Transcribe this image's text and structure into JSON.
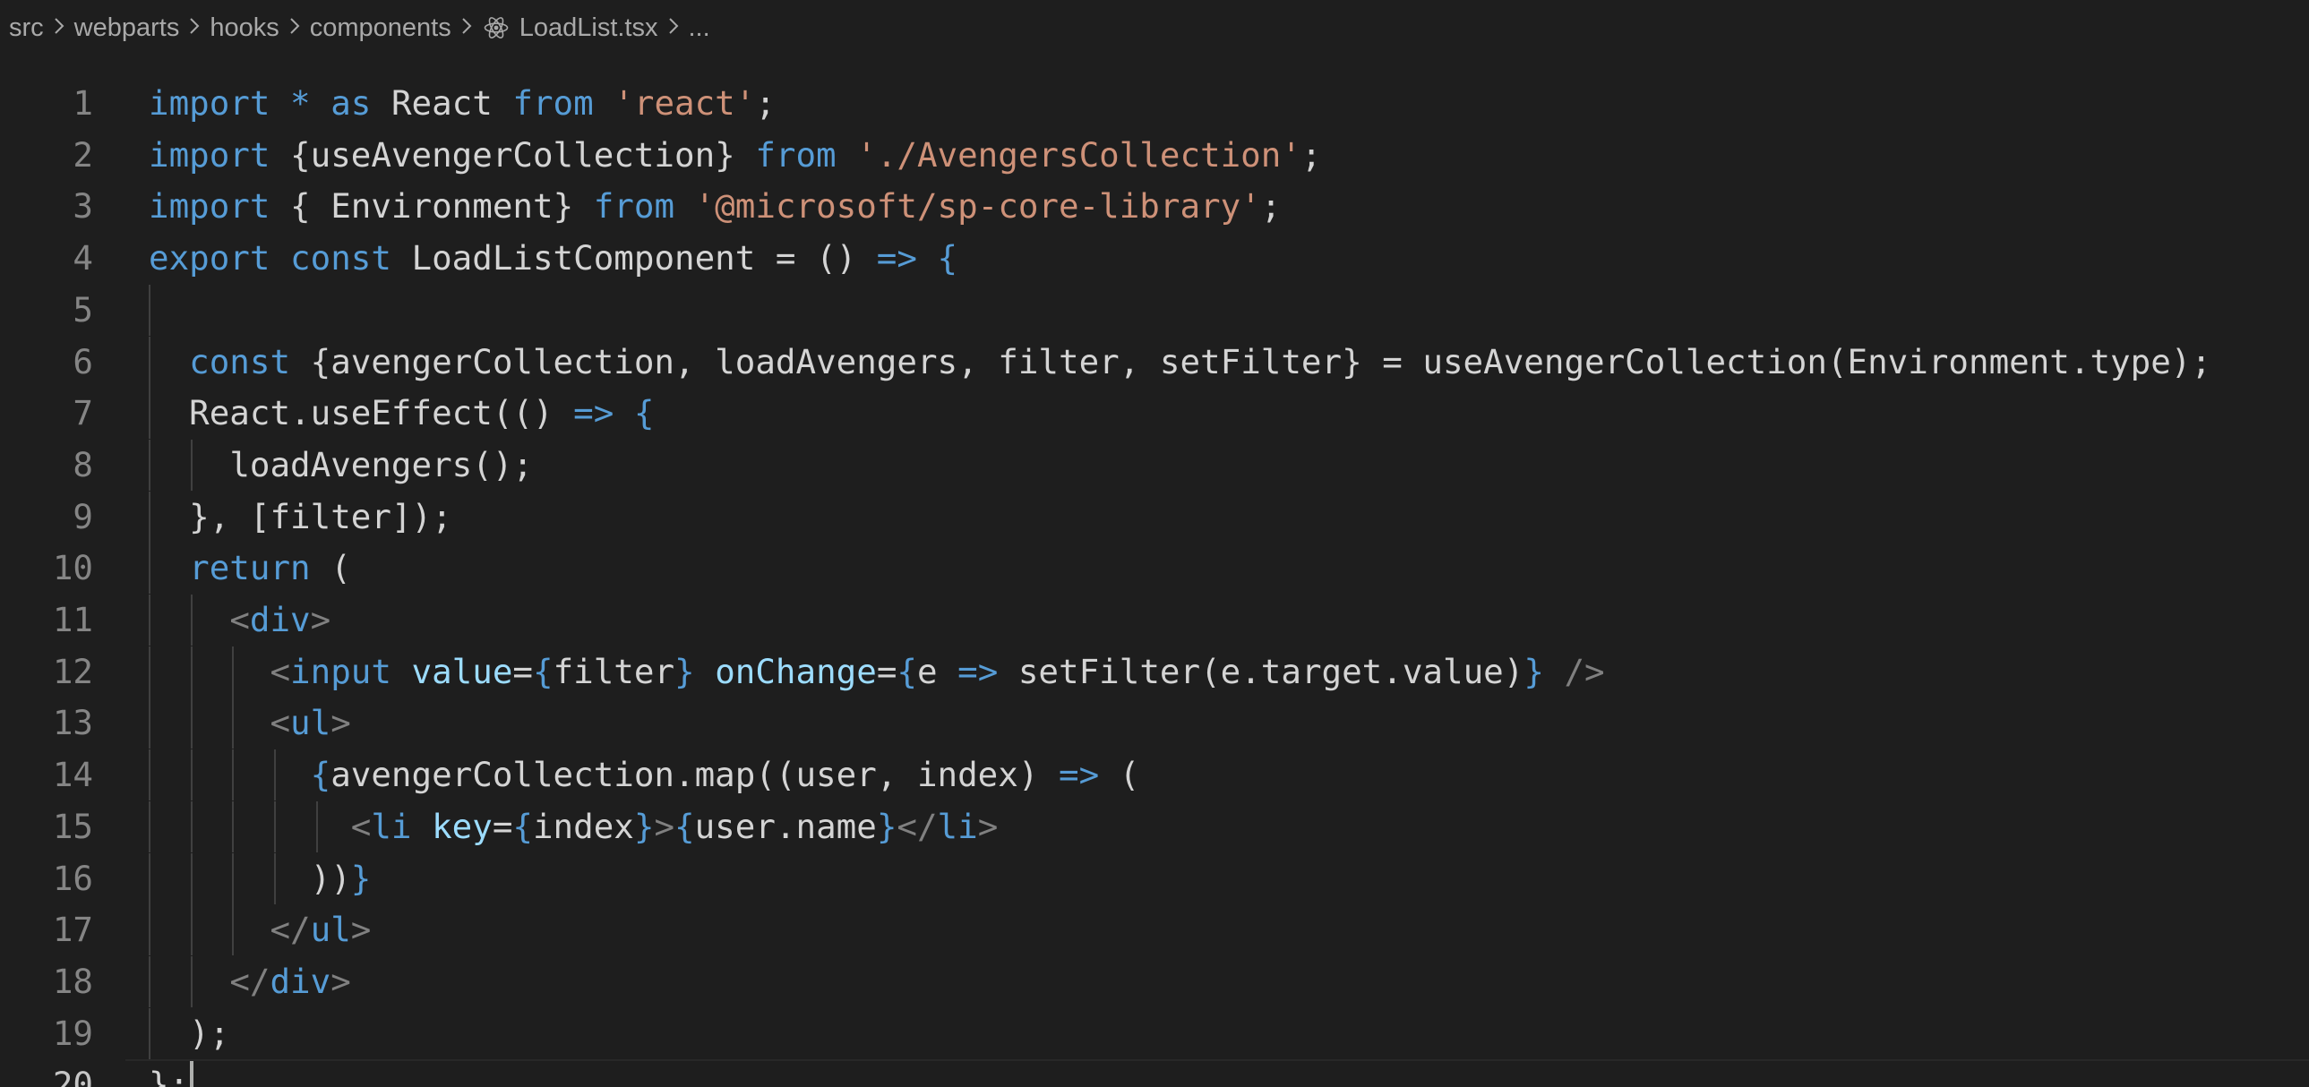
{
  "breadcrumb": {
    "items": [
      "src",
      "webparts",
      "hooks",
      "components",
      "LoadList.tsx",
      "..."
    ],
    "file_icon": "react-icon"
  },
  "editor": {
    "active_line": 20,
    "lines": [
      {
        "n": "1",
        "code": "import * as React from 'react';"
      },
      {
        "n": "2",
        "code": "import {useAvengerCollection} from './AvengersCollection';"
      },
      {
        "n": "3",
        "code": "import { Environment} from '@microsoft/sp-core-library';"
      },
      {
        "n": "4",
        "code": "export const LoadListComponent = () => {"
      },
      {
        "n": "5",
        "code": ""
      },
      {
        "n": "6",
        "code": "  const {avengerCollection, loadAvengers, filter, setFilter} = useAvengerCollection(Environment.type);"
      },
      {
        "n": "7",
        "code": "  React.useEffect(() => {"
      },
      {
        "n": "8",
        "code": "    loadAvengers();"
      },
      {
        "n": "9",
        "code": "  }, [filter]);"
      },
      {
        "n": "10",
        "code": "  return ("
      },
      {
        "n": "11",
        "code": "    <div>"
      },
      {
        "n": "12",
        "code": "      <input value={filter} onChange={e => setFilter(e.target.value)} />"
      },
      {
        "n": "13",
        "code": "      <ul>"
      },
      {
        "n": "14",
        "code": "        {avengerCollection.map((user, index) => ("
      },
      {
        "n": "15",
        "code": "          <li key={index}>{user.name}</li>"
      },
      {
        "n": "16",
        "code": "        ))}"
      },
      {
        "n": "17",
        "code": "      </ul>"
      },
      {
        "n": "18",
        "code": "    </div>"
      },
      {
        "n": "19",
        "code": "  );"
      },
      {
        "n": "20",
        "code": "};"
      }
    ]
  },
  "colors": {
    "background": "#1e1e1e",
    "keyword": "#569cd6",
    "string": "#ce9178",
    "variable": "#9cdcfe",
    "text": "#d4d4d4",
    "line_number": "#858585",
    "line_number_active": "#c6c6c6"
  }
}
